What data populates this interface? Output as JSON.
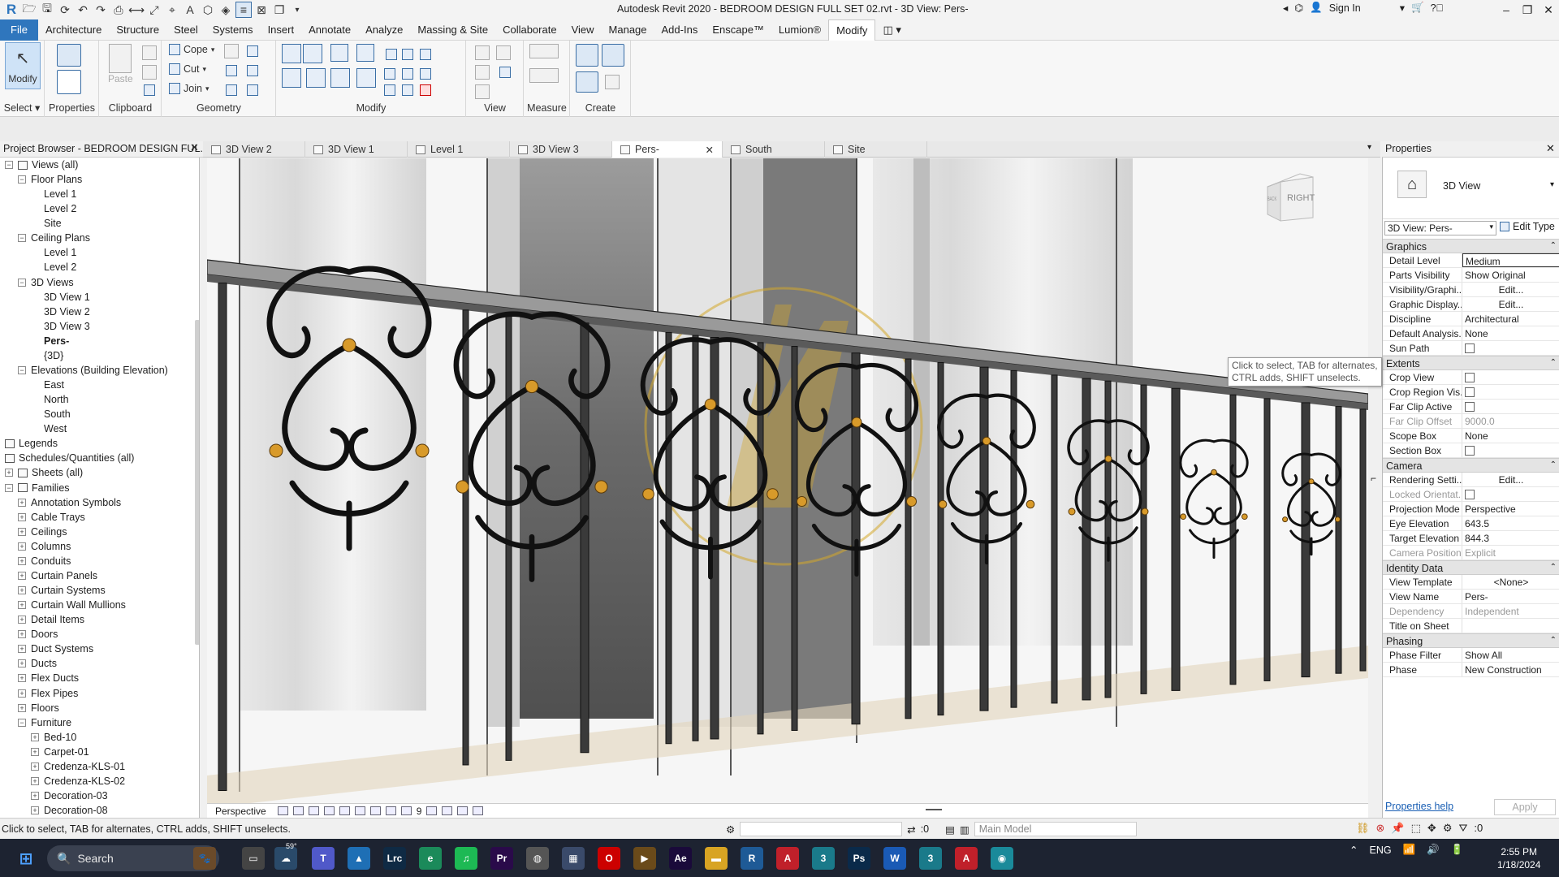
{
  "app": {
    "title": "Autodesk Revit 2020 - BEDROOM DESIGN FULL SET 02.rvt - 3D View: Pers-",
    "sign_in": "Sign In"
  },
  "menu": {
    "tabs": [
      "File",
      "Architecture",
      "Structure",
      "Steel",
      "Systems",
      "Insert",
      "Annotate",
      "Analyze",
      "Massing & Site",
      "Collaborate",
      "View",
      "Manage",
      "Add-Ins",
      "Enscape™",
      "Lumion®",
      "Modify"
    ],
    "active": "Modify"
  },
  "ribbon": {
    "select": {
      "modify": "Modify",
      "label": "Select ▾"
    },
    "properties": {
      "label": "Properties"
    },
    "clipboard": {
      "paste": "Paste",
      "label": "Clipboard"
    },
    "geometry": {
      "cope": "Cope",
      "cut": "Cut",
      "join": "Join",
      "label": "Geometry"
    },
    "modify": {
      "label": "Modify"
    },
    "view": {
      "label": "View"
    },
    "measure": {
      "label": "Measure"
    },
    "create": {
      "label": "Create"
    }
  },
  "project_browser": {
    "title": "Project Browser - BEDROOM DESIGN FUL...",
    "items": [
      {
        "label": "Views (all)",
        "level": 0,
        "toggle": "−",
        "icon": true
      },
      {
        "label": "Floor Plans",
        "level": 1,
        "toggle": "−"
      },
      {
        "label": "Level 1",
        "level": 2
      },
      {
        "label": "Level 2",
        "level": 2
      },
      {
        "label": "Site",
        "level": 2
      },
      {
        "label": "Ceiling Plans",
        "level": 1,
        "toggle": "−"
      },
      {
        "label": "Level 1",
        "level": 2
      },
      {
        "label": "Level 2",
        "level": 2
      },
      {
        "label": "3D Views",
        "level": 1,
        "toggle": "−"
      },
      {
        "label": "3D View 1",
        "level": 2
      },
      {
        "label": "3D View 2",
        "level": 2
      },
      {
        "label": "3D View 3",
        "level": 2
      },
      {
        "label": "Pers-",
        "level": 2,
        "bold": true
      },
      {
        "label": "{3D}",
        "level": 2
      },
      {
        "label": "Elevations (Building Elevation)",
        "level": 1,
        "toggle": "−"
      },
      {
        "label": "East",
        "level": 2
      },
      {
        "label": "North",
        "level": 2
      },
      {
        "label": "South",
        "level": 2
      },
      {
        "label": "West",
        "level": 2
      },
      {
        "label": "Legends",
        "level": 0,
        "icon": true
      },
      {
        "label": "Schedules/Quantities (all)",
        "level": 0,
        "icon": true
      },
      {
        "label": "Sheets (all)",
        "level": 0,
        "toggle": "+",
        "icon": true
      },
      {
        "label": "Families",
        "level": 0,
        "toggle": "−",
        "icon": true
      },
      {
        "label": "Annotation Symbols",
        "level": 1,
        "toggle": "+"
      },
      {
        "label": "Cable Trays",
        "level": 1,
        "toggle": "+"
      },
      {
        "label": "Ceilings",
        "level": 1,
        "toggle": "+"
      },
      {
        "label": "Columns",
        "level": 1,
        "toggle": "+"
      },
      {
        "label": "Conduits",
        "level": 1,
        "toggle": "+"
      },
      {
        "label": "Curtain Panels",
        "level": 1,
        "toggle": "+"
      },
      {
        "label": "Curtain Systems",
        "level": 1,
        "toggle": "+"
      },
      {
        "label": "Curtain Wall Mullions",
        "level": 1,
        "toggle": "+"
      },
      {
        "label": "Detail Items",
        "level": 1,
        "toggle": "+"
      },
      {
        "label": "Doors",
        "level": 1,
        "toggle": "+"
      },
      {
        "label": "Duct Systems",
        "level": 1,
        "toggle": "+"
      },
      {
        "label": "Ducts",
        "level": 1,
        "toggle": "+"
      },
      {
        "label": "Flex Ducts",
        "level": 1,
        "toggle": "+"
      },
      {
        "label": "Flex Pipes",
        "level": 1,
        "toggle": "+"
      },
      {
        "label": "Floors",
        "level": 1,
        "toggle": "+"
      },
      {
        "label": "Furniture",
        "level": 1,
        "toggle": "−"
      },
      {
        "label": "Bed-10",
        "level": 2,
        "toggle": "+"
      },
      {
        "label": "Carpet-01",
        "level": 2,
        "toggle": "+"
      },
      {
        "label": "Credenza-KLS-01",
        "level": 2,
        "toggle": "+"
      },
      {
        "label": "Credenza-KLS-02",
        "level": 2,
        "toggle": "+"
      },
      {
        "label": "Decoration-03",
        "level": 2,
        "toggle": "+"
      },
      {
        "label": "Decoration-08",
        "level": 2,
        "toggle": "+"
      }
    ]
  },
  "view_tabs": [
    {
      "label": "3D View 2"
    },
    {
      "label": "3D View 1"
    },
    {
      "label": "Level 1"
    },
    {
      "label": "3D View 3"
    },
    {
      "label": "Pers-",
      "active": true
    },
    {
      "label": "South"
    },
    {
      "label": "Site"
    }
  ],
  "viewcube": {
    "face": "RIGHT",
    "side": "BACK"
  },
  "view_status": {
    "mode": "Perspective",
    "scale": "9"
  },
  "properties": {
    "title": "Properties",
    "type_name": "3D View",
    "instance": "3D View: Pers-",
    "edit_type": "Edit Type",
    "sections": [
      {
        "name": "Graphics",
        "rows": [
          {
            "k": "Detail Level",
            "v": "Medium",
            "boxed": true
          },
          {
            "k": "Parts Visibility",
            "v": "Show Original"
          },
          {
            "k": "Visibility/Graphi...",
            "v": "Edit...",
            "btn": true
          },
          {
            "k": "Graphic Display...",
            "v": "Edit...",
            "btn": true
          },
          {
            "k": "Discipline",
            "v": "Architectural"
          },
          {
            "k": "Default Analysis...",
            "v": "None"
          },
          {
            "k": "Sun Path",
            "v": "",
            "check": true
          }
        ]
      },
      {
        "name": "Extents",
        "rows": [
          {
            "k": "Crop View",
            "v": "",
            "check": true
          },
          {
            "k": "Crop Region Vis...",
            "v": "",
            "check": true
          },
          {
            "k": "Far Clip Active",
            "v": "",
            "check": true
          },
          {
            "k": "Far Clip Offset",
            "v": "9000.0",
            "dim": true
          },
          {
            "k": "Scope Box",
            "v": "None"
          },
          {
            "k": "Section Box",
            "v": "",
            "check": true
          }
        ]
      },
      {
        "name": "Camera",
        "rows": [
          {
            "k": "Rendering Setti...",
            "v": "Edit...",
            "btn": true
          },
          {
            "k": "Locked Orientat...",
            "v": "",
            "check": true,
            "dim": true
          },
          {
            "k": "Projection Mode",
            "v": "Perspective"
          },
          {
            "k": "Eye Elevation",
            "v": "643.5"
          },
          {
            "k": "Target Elevation",
            "v": "844.3"
          },
          {
            "k": "Camera Position",
            "v": "Explicit",
            "dim": true
          }
        ]
      },
      {
        "name": "Identity Data",
        "rows": [
          {
            "k": "View Template",
            "v": "<None>",
            "btn": true
          },
          {
            "k": "View Name",
            "v": "Pers-"
          },
          {
            "k": "Dependency",
            "v": "Independent",
            "dim": true
          },
          {
            "k": "Title on Sheet",
            "v": ""
          }
        ]
      },
      {
        "name": "Phasing",
        "rows": [
          {
            "k": "Phase Filter",
            "v": "Show All"
          },
          {
            "k": "Phase",
            "v": "New Construction"
          }
        ]
      }
    ],
    "help": "Properties help",
    "apply": "Apply"
  },
  "tooltip": "Click to select, TAB for alternates, CTRL adds, SHIFT unselects.",
  "statusbar": {
    "hint": "Click to select, TAB for alternates, CTRL adds, SHIFT unselects.",
    "zero": ":0",
    "model": "Main Model",
    "filter": ":0"
  },
  "taskbar": {
    "search": "Search",
    "lang": "ENG",
    "time": "2:55 PM",
    "date": "1/18/2024",
    "weather": "59°"
  }
}
